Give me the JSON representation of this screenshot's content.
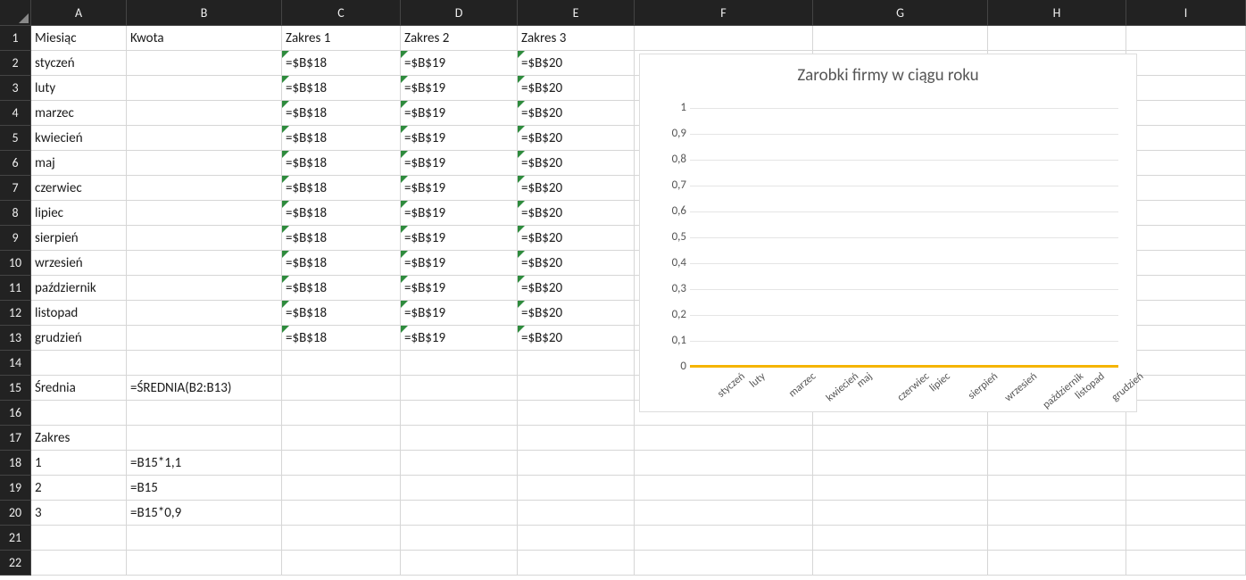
{
  "columns": [
    "A",
    "B",
    "C",
    "D",
    "E",
    "F",
    "G",
    "H",
    "I"
  ],
  "col_widths": [
    "wA",
    "wB",
    "wC",
    "wD",
    "wE",
    "wF",
    "wG",
    "wH",
    "wI"
  ],
  "row_count": 22,
  "header_row": {
    "A": "Miesiąc",
    "B": "Kwota",
    "C": "Zakres 1",
    "D": "Zakres 2",
    "E": "Zakres 3"
  },
  "months": [
    "styczeń",
    "luty",
    "marzec",
    "kwiecień",
    "maj",
    "czerwiec",
    "lipiec",
    "sierpień",
    "wrzesień",
    "październik",
    "listopad",
    "grudzień"
  ],
  "formula_row": {
    "C": "=$B$18",
    "D": "=$B$19",
    "E": "=$B$20"
  },
  "row15": {
    "A": "Średnia",
    "B": "=ŚREDNIA(B2:B13)"
  },
  "row17": {
    "A": "Zakres"
  },
  "row18": {
    "A": "1",
    "B": "=B15*1,1"
  },
  "row19": {
    "A": "2",
    "B": "=B15"
  },
  "row20": {
    "A": "3",
    "B": "=B15*0,9"
  },
  "chart_data": {
    "type": "line",
    "title": "Zarobki firmy w ciągu roku",
    "categories": [
      "styczeń",
      "luty",
      "marzec",
      "kwiecień",
      "maj",
      "czerwiec",
      "lipiec",
      "sierpień",
      "wrzesień",
      "październik",
      "listopad",
      "grudzień"
    ],
    "values": [
      0,
      0,
      0,
      0,
      0,
      0,
      0,
      0,
      0,
      0,
      0,
      0
    ],
    "ylim": [
      0,
      1
    ],
    "yticks": [
      "1",
      "0,9",
      "0,8",
      "0,7",
      "0,6",
      "0,5",
      "0,4",
      "0,3",
      "0,2",
      "0,1",
      "0"
    ],
    "xlabel": "",
    "ylabel": "",
    "line_color": "#f5b400"
  }
}
